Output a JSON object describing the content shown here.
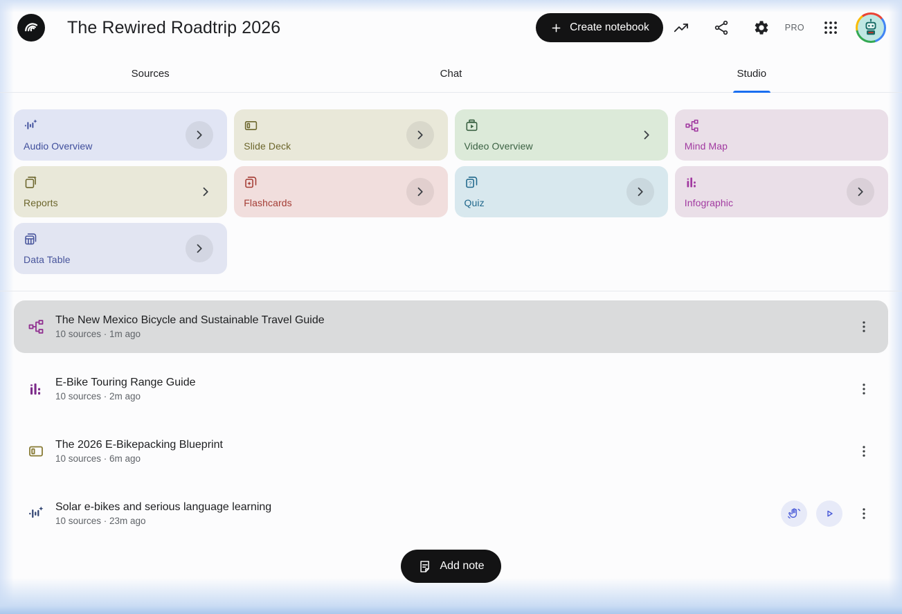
{
  "header": {
    "title": "The Rewired Roadtrip 2026",
    "create_button": "Create notebook",
    "pro_badge": "PRO"
  },
  "tabs": [
    {
      "id": "sources",
      "label": "Sources",
      "active": false
    },
    {
      "id": "chat",
      "label": "Chat",
      "active": false
    },
    {
      "id": "studio",
      "label": "Studio",
      "active": true
    }
  ],
  "studio_cards": [
    {
      "id": "audio-overview",
      "label": "Audio Overview",
      "icon": "audio-waveform",
      "bg": "#e1e5f4",
      "fg": "#3e4d9b",
      "chevron": "circle"
    },
    {
      "id": "slide-deck",
      "label": "Slide Deck",
      "icon": "slide-deck",
      "bg": "#e9e8d9",
      "fg": "#6c662c",
      "chevron": "circle"
    },
    {
      "id": "video-overview",
      "label": "Video Overview",
      "icon": "video-overview",
      "bg": "#dcead9",
      "fg": "#3a6142",
      "chevron": "plain"
    },
    {
      "id": "mind-map",
      "label": "Mind Map",
      "icon": "mind-map",
      "bg": "#eadfe8",
      "fg": "#a139a0",
      "chevron": "none"
    },
    {
      "id": "reports",
      "label": "Reports",
      "icon": "reports",
      "bg": "#e9e8d9",
      "fg": "#6c662c",
      "chevron": "plain"
    },
    {
      "id": "flashcards",
      "label": "Flashcards",
      "icon": "flashcards",
      "bg": "#f1dedd",
      "fg": "#a43c34",
      "chevron": "circle"
    },
    {
      "id": "quiz",
      "label": "Quiz",
      "icon": "quiz",
      "bg": "#d8e8ee",
      "fg": "#20688c",
      "chevron": "circle"
    },
    {
      "id": "infographic",
      "label": "Infographic",
      "icon": "infographic",
      "bg": "#eadfe8",
      "fg": "#a139a0",
      "chevron": "circle"
    },
    {
      "id": "data-table",
      "label": "Data Table",
      "icon": "data-table",
      "bg": "#e2e5f2",
      "fg": "#47549b",
      "chevron": "circle"
    }
  ],
  "artifacts": [
    {
      "icon": "mind-map",
      "icon_color": "#902f90",
      "title": "The New Mexico Bicycle and Sustainable Travel Guide",
      "meta": "10 sources · 1m ago",
      "selected": true,
      "actions": []
    },
    {
      "icon": "infographic",
      "icon_color": "#7c2b8a",
      "title": "E-Bike Touring Range Guide",
      "meta": "10 sources · 2m ago",
      "selected": false,
      "actions": []
    },
    {
      "icon": "slide-deck",
      "icon_color": "#877a33",
      "title": "The 2026 E-Bikepacking Blueprint",
      "meta": "10 sources · 6m ago",
      "selected": false,
      "actions": []
    },
    {
      "icon": "audio-waveform",
      "icon_color": "#2e4170",
      "title": "Solar e-bikes and serious language learning",
      "meta": "10 sources · 23m ago",
      "selected": false,
      "actions": [
        "interactive-mode",
        "play"
      ]
    }
  ],
  "add_note": {
    "label": "Add note"
  },
  "colors": {
    "accent_blue": "#1a6ef0",
    "pill_black": "#131314",
    "selected_row": "#dadbdc",
    "meta_text": "#5f6368",
    "action_circle_bg": "#e7eaf8",
    "action_icon": "#4a5bd8"
  }
}
